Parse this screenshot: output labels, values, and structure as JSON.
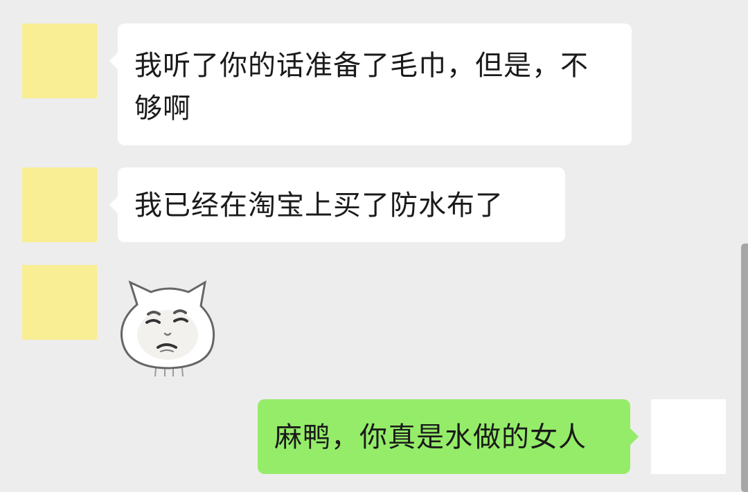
{
  "messages": [
    {
      "side": "incoming",
      "type": "text",
      "text": "我听了你的话准备了毛巾，但是，不够啊"
    },
    {
      "side": "incoming",
      "type": "text",
      "text": "我已经在淘宝上买了防水布了"
    },
    {
      "side": "incoming",
      "type": "sticker",
      "sticker": "pouting-cat-face-sticker"
    },
    {
      "side": "outgoing",
      "type": "text",
      "text": "麻鸭，你真是水做的女人"
    }
  ],
  "colors": {
    "background": "#ededed",
    "incoming_bubble": "#ffffff",
    "outgoing_bubble": "#95ec69",
    "contact_avatar": "#f9ee93",
    "self_avatar": "#ffffff"
  }
}
